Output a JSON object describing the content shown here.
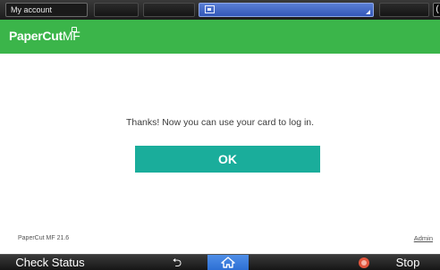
{
  "topbar": {
    "account_label": "My account",
    "end_label": "("
  },
  "brand": {
    "logo_text": "PaperCut",
    "logo_suffix": "MF"
  },
  "main": {
    "message": "Thanks! Now you can use your card to log in.",
    "ok_label": "OK"
  },
  "footer": {
    "version": "PaperCut MF 21.6",
    "admin_link": "Admin"
  },
  "device_bar": {
    "check_status_label": "Check Status",
    "stop_label": "Stop"
  },
  "colors": {
    "brand_green": "#3bb54a",
    "ok_button_teal": "#1aad9b",
    "home_blue": "#2d6fd4",
    "stop_red": "#e3543c"
  },
  "icons": [
    "window-icon",
    "back-arrow-icon",
    "home-icon",
    "stop-icon"
  ]
}
